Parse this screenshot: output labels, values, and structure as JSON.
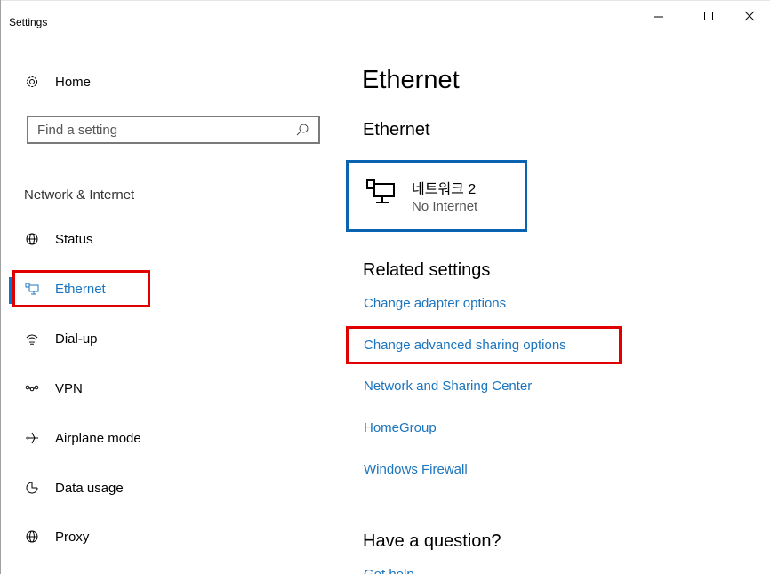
{
  "window": {
    "title": "Settings"
  },
  "sidebar": {
    "home_label": "Home",
    "search_placeholder": "Find a setting",
    "section_label": "Network & Internet",
    "items": [
      {
        "label": "Status",
        "icon": "status-globe-icon"
      },
      {
        "label": "Ethernet",
        "icon": "ethernet-icon",
        "active": true
      },
      {
        "label": "Dial-up",
        "icon": "dial-up-icon"
      },
      {
        "label": "VPN",
        "icon": "vpn-icon"
      },
      {
        "label": "Airplane mode",
        "icon": "airplane-icon"
      },
      {
        "label": "Data usage",
        "icon": "data-usage-icon"
      },
      {
        "label": "Proxy",
        "icon": "proxy-globe-icon"
      }
    ]
  },
  "main": {
    "page_title": "Ethernet",
    "section_title": "Ethernet",
    "network": {
      "name": "네트워크 2",
      "status": "No Internet"
    },
    "related_title": "Related settings",
    "related_links": [
      "Change adapter options",
      "Change advanced sharing options",
      "Network and Sharing Center",
      "HomeGroup",
      "Windows Firewall"
    ],
    "question_title": "Have a question?",
    "get_help": "Get help"
  },
  "colors": {
    "accent": "#0078d7",
    "link": "#1b74be",
    "highlight": "#e00000",
    "card_border": "#0a63b0"
  }
}
